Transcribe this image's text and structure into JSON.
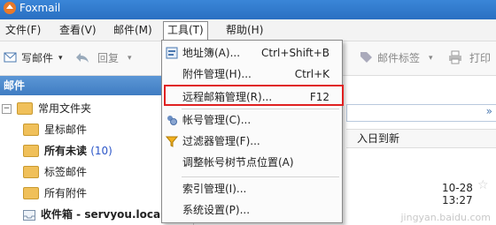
{
  "app_title": "Foxmail",
  "menubar": {
    "file": "文件(F)",
    "view": "查看(V)",
    "mail": "邮件(M)",
    "tools": "工具(T)",
    "help": "帮助(H)"
  },
  "toolbar": {
    "write": "写邮件",
    "reply": "回复",
    "tag": "邮件标签",
    "print": "打印"
  },
  "sidebar": {
    "header": "邮件",
    "items": [
      {
        "label": "常用文件夹"
      },
      {
        "label": "星标邮件"
      },
      {
        "label": "所有未读",
        "count": "(10)"
      },
      {
        "label": "标签邮件"
      },
      {
        "label": "所有附件"
      },
      {
        "label": "收件箱 - servyou.local"
      }
    ]
  },
  "list": {
    "column_hint": "入日到新",
    "date": "10-28 13:27"
  },
  "tools_menu": {
    "items": [
      {
        "label": "地址簿(A)...",
        "shortcut": "Ctrl+Shift+B"
      },
      {
        "label": "附件管理(H)...",
        "shortcut": "Ctrl+K"
      },
      {
        "label": "远程邮箱管理(R)...",
        "shortcut": "F12"
      },
      {
        "label": "帐号管理(C)..."
      },
      {
        "label": "过滤器管理(F)..."
      },
      {
        "label": "调整帐号树节点位置(A)"
      },
      {
        "label": "索引管理(I)..."
      },
      {
        "label": "系统设置(P)..."
      }
    ]
  },
  "watermark": "jingyan.baidu.com",
  "colors": {
    "highlight_border": "#e02020",
    "titlebar": "#2a6fc2"
  }
}
